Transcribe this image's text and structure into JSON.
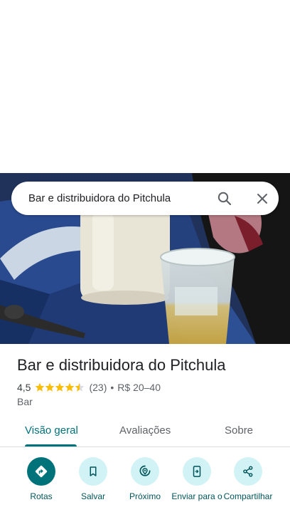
{
  "search": {
    "query": "Bar e distribuidora do Pitchula"
  },
  "place": {
    "name": "Bar e distribuidora do Pitchula",
    "rating": "4,5",
    "stars": 4.5,
    "reviews": "(23)",
    "bullet": "•",
    "price": "R$ 20–40",
    "category": "Bar"
  },
  "tabs": [
    {
      "label": "Visão geral",
      "active": true
    },
    {
      "label": "Avaliações",
      "active": false
    },
    {
      "label": "Sobre",
      "active": false
    }
  ],
  "actions": [
    {
      "label": "Rotas",
      "icon": "directions-icon"
    },
    {
      "label": "Salvar",
      "icon": "bookmark-icon"
    },
    {
      "label": "Próximo",
      "icon": "nearby-icon"
    },
    {
      "label": "Enviar para o",
      "icon": "send-to-phone-icon"
    },
    {
      "label": "Compartilhar",
      "icon": "share-icon"
    }
  ],
  "colors": {
    "accent": "#00737a",
    "accent_light": "#d2f3f5",
    "star": "#fbbc04"
  }
}
